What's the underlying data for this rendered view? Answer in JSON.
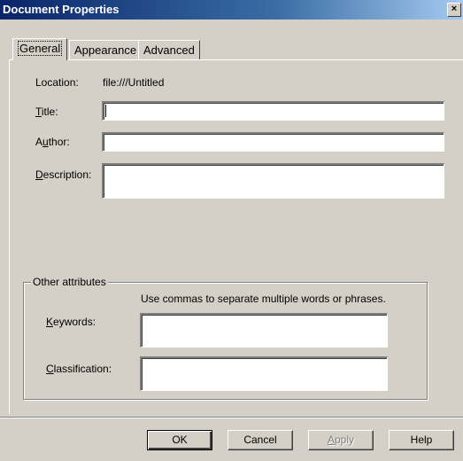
{
  "window": {
    "title": "Document Properties",
    "close_glyph": "×"
  },
  "tabs": [
    {
      "label": "General",
      "active": true
    },
    {
      "label": "Appearance",
      "active": false
    },
    {
      "label": "Advanced",
      "active": false
    }
  ],
  "general": {
    "location_label": "Location:",
    "location_value": "file:///Untitled",
    "title_label": "Title:",
    "title_value": "",
    "author_label": "Author:",
    "author_value": "",
    "description_label": "Description:",
    "description_value": ""
  },
  "other_attributes": {
    "group_title": "Other attributes",
    "hint": "Use commas to separate multiple words or phrases.",
    "keywords_label": "Keywords:",
    "keywords_value": "",
    "classification_label": "Classification:",
    "classification_value": ""
  },
  "buttons": {
    "ok": "OK",
    "cancel": "Cancel",
    "apply": "Apply",
    "help": "Help"
  }
}
